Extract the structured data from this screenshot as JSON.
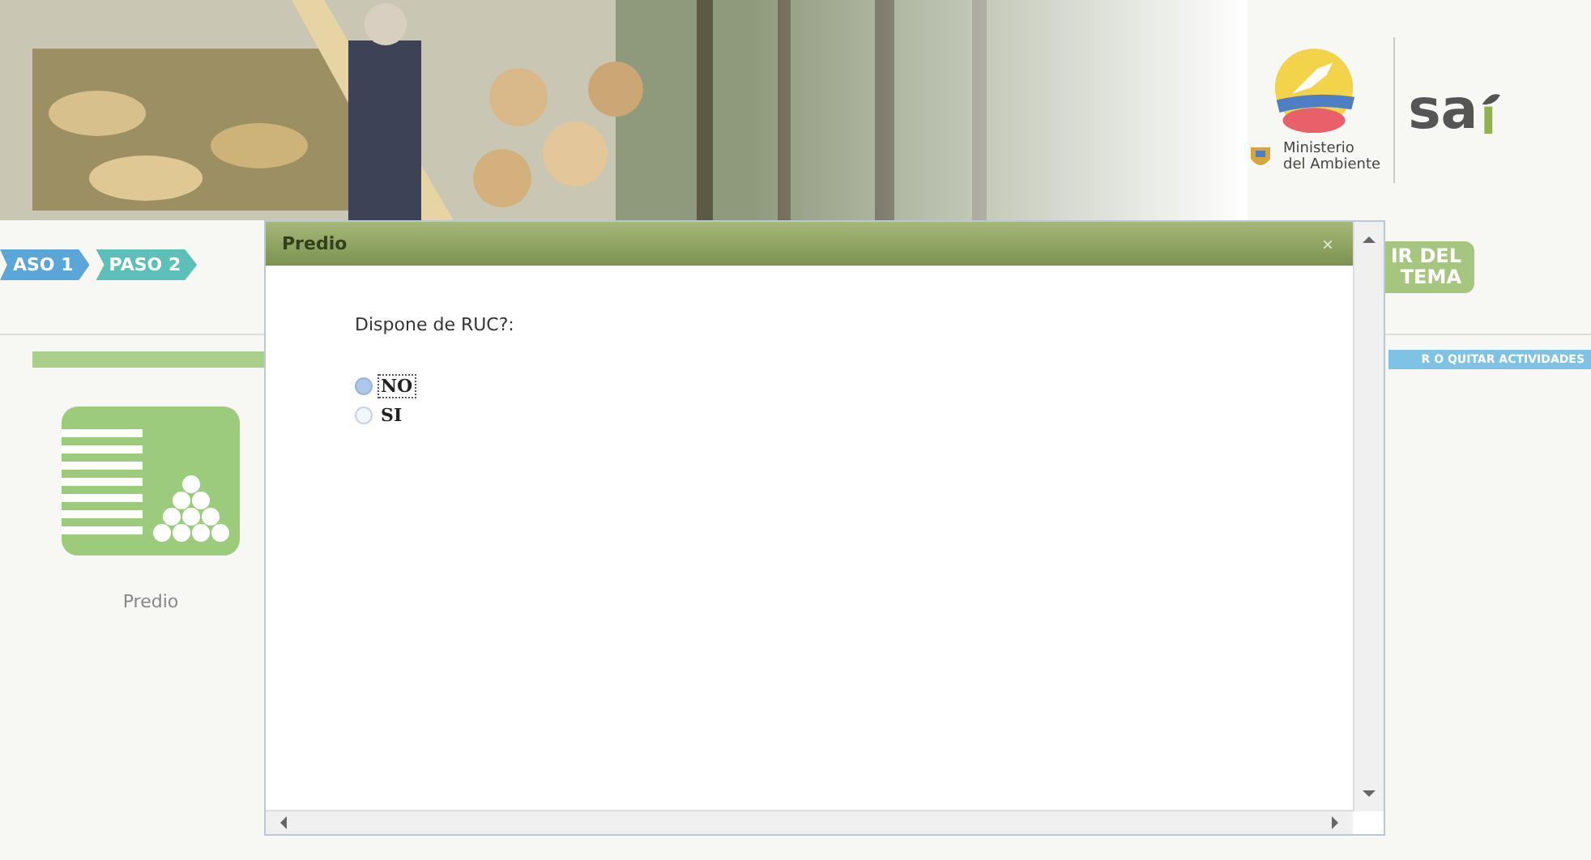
{
  "header": {
    "ministry": [
      "Ministerio",
      "del Ambiente"
    ],
    "sai_logo": "sa"
  },
  "steps": [
    {
      "label": "ASO 1",
      "color": "#5aa6d8"
    },
    {
      "label": "PASO 2",
      "color": "#5cc0b8"
    }
  ],
  "system_button": [
    "IR DEL",
    "TEMA"
  ],
  "activities_bar": "R O QUITAR ACTIVIDADES",
  "tile": {
    "label": "Predio"
  },
  "dialog": {
    "title": "Predio",
    "close": "×",
    "question": "Dispone de RUC?:",
    "options": [
      {
        "label": "NO",
        "selected": true
      },
      {
        "label": "SI",
        "selected": false
      }
    ]
  }
}
